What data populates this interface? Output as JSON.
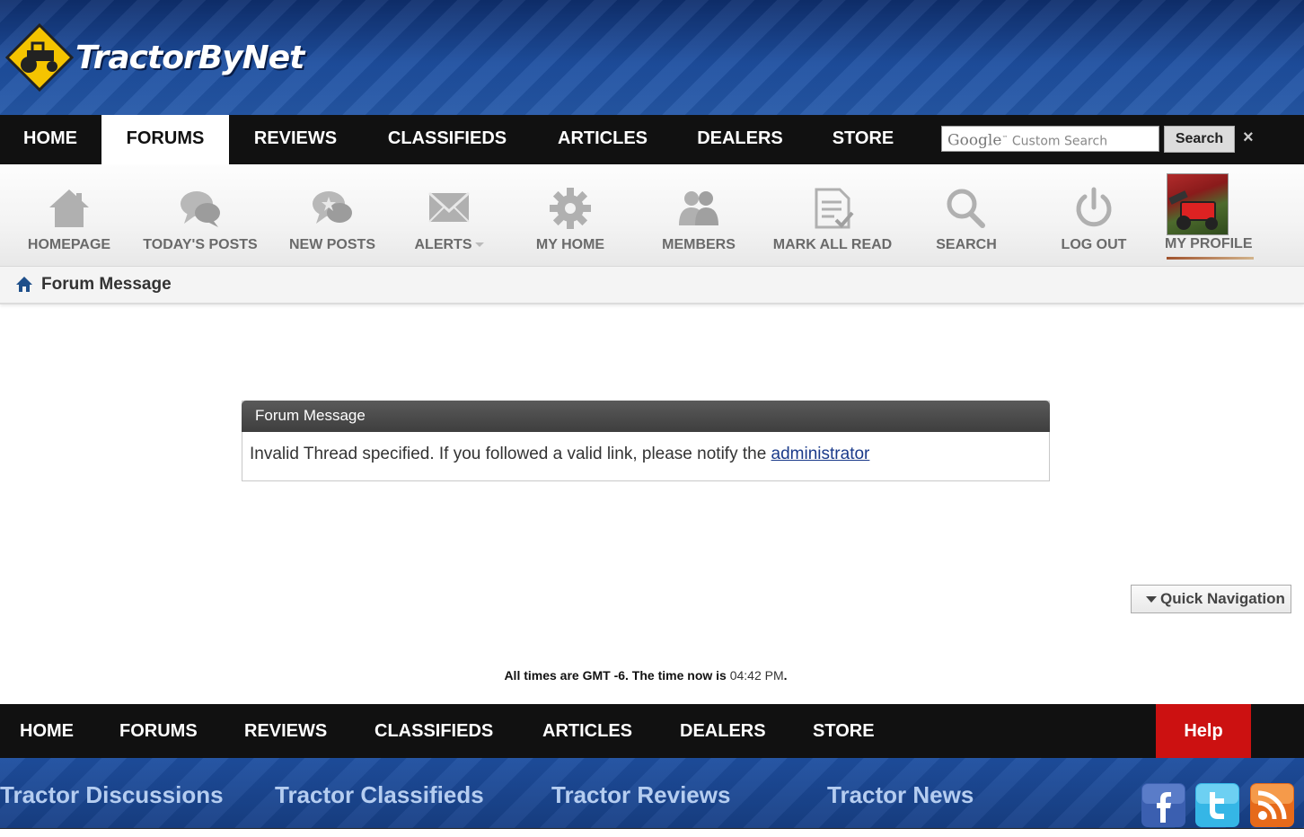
{
  "brand": {
    "logo_text": "TractorByNet"
  },
  "top_nav": {
    "items": [
      "HOME",
      "FORUMS",
      "REVIEWS",
      "CLASSIFIEDS",
      "ARTICLES",
      "DEALERS",
      "STORE"
    ],
    "active": "FORUMS"
  },
  "search": {
    "google_label": "Google",
    "placeholder": "Custom Search",
    "button_label": "Search",
    "close_symbol": "×"
  },
  "toolbar": {
    "items": [
      {
        "label": "HOMEPAGE",
        "icon": "house-icon"
      },
      {
        "label": "TODAY'S POSTS",
        "icon": "chat-bubbles-icon"
      },
      {
        "label": "NEW POSTS",
        "icon": "star-bubble-icon"
      },
      {
        "label": "ALERTS",
        "icon": "envelope-icon"
      },
      {
        "label": "MY HOME",
        "icon": "gear-icon"
      },
      {
        "label": "MEMBERS",
        "icon": "people-icon"
      },
      {
        "label": "MARK ALL READ",
        "icon": "document-check-icon"
      },
      {
        "label": "SEARCH",
        "icon": "magnifier-icon"
      },
      {
        "label": "LOG OUT",
        "icon": "power-icon"
      }
    ],
    "profile_label": "MY PROFILE"
  },
  "breadcrumb": {
    "title": "Forum Message"
  },
  "message": {
    "header": "Forum Message",
    "text": "Invalid Thread specified. If you followed a valid link, please notify the",
    "link_text": "administrator"
  },
  "quick_nav": {
    "label": "Quick Navigation"
  },
  "time_info": {
    "prefix": "All times are GMT -6. The time now is",
    "time": "04:42 PM",
    "suffix": "."
  },
  "footer_nav": {
    "items": [
      "HOME",
      "FORUMS",
      "REVIEWS",
      "CLASSIFIEDS",
      "ARTICLES",
      "DEALERS",
      "STORE"
    ],
    "help": "Help"
  },
  "footer_links": [
    "Tractor Discussions",
    "Tractor Classifieds",
    "Tractor Reviews",
    "Tractor News"
  ],
  "social": [
    "facebook-icon",
    "twitter-icon",
    "rss-icon"
  ],
  "colors": {
    "banner_blue": "#1e4fa0",
    "nav_black": "#111111",
    "help_red": "#cc1111",
    "link_blue": "#1a3a8a"
  }
}
